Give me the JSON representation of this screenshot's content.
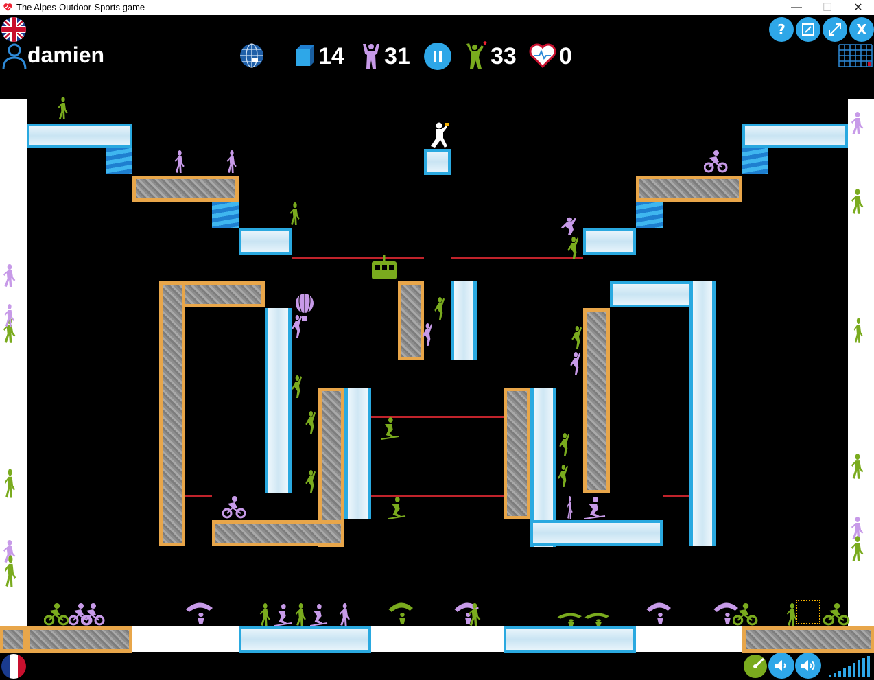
{
  "window": {
    "title": "The Alpes-Outdoor-Sports game",
    "controls": [
      "minimize",
      "maximize",
      "close"
    ]
  },
  "hud": {
    "username": "damien",
    "blocks_count": "14",
    "strength_count": "31",
    "players_count": "33",
    "hearts_count": "0",
    "buttons": {
      "help": "?",
      "close": "X"
    },
    "icons": [
      "uk-flag-icon",
      "user-icon",
      "globe-icon",
      "block-icon",
      "strongman-icon",
      "pause-icon",
      "cheering-player-icon",
      "heart-icon",
      "grid-icon",
      "help-icon",
      "edit-icon",
      "fullscreen-icon",
      "close-icon",
      "france-flag-icon",
      "speed-dial-icon",
      "sound-down-icon",
      "sound-up-icon",
      "signal-bars-icon"
    ]
  },
  "colors": {
    "background": "#000000",
    "ice_border": "#2aa9e0",
    "rock_border": "#e8a64a",
    "rail": "#c0232b",
    "figure_green": "#7aab1e",
    "figure_purple": "#c79ae8",
    "button_blue": "#2ea7e8"
  }
}
